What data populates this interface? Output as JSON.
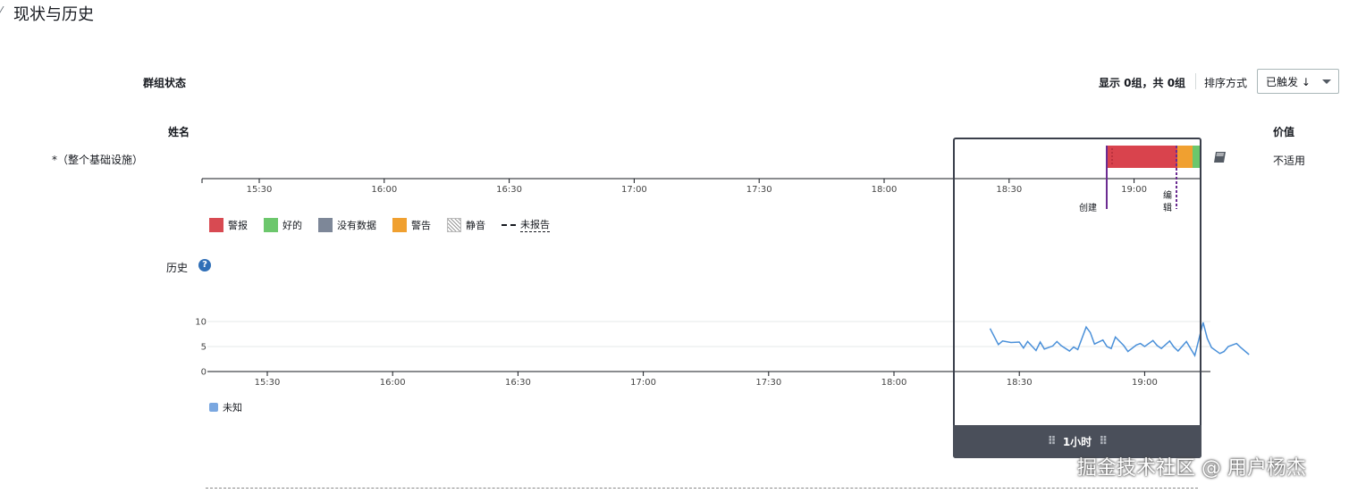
{
  "section": {
    "caret": "⁄",
    "title": "现状与历史"
  },
  "group_status": {
    "heading": "群组状态",
    "display_count": "显示 0组，共 0组",
    "sort_label": "排序方式",
    "sort_value": "已触发 ↓"
  },
  "table": {
    "col_name": "姓名",
    "col_value": "价值",
    "row": {
      "name": "*（整个基础设施）",
      "value": "不适用",
      "icon": "book-icon"
    }
  },
  "timeline": {
    "ticks": [
      "15:30",
      "16:00",
      "16:30",
      "17:00",
      "17:30",
      "18:00",
      "18:30",
      "19:00"
    ],
    "markers": {
      "create": "创建",
      "edit_1": "编",
      "edit_2": "辑"
    },
    "state_bar": [
      {
        "state": "警报",
        "fraction": 0.7,
        "color": "#d13212"
      },
      {
        "state": "警告",
        "fraction": 0.15,
        "color": "#f0a030"
      },
      {
        "state": "好的",
        "fraction": 0.1,
        "color": "#6cc76c"
      }
    ]
  },
  "legend": [
    {
      "label": "警报",
      "color": "#d84a52",
      "kind": "swatch"
    },
    {
      "label": "好的",
      "color": "#6cc76c",
      "kind": "swatch"
    },
    {
      "label": "没有数据",
      "color": "#7d8798",
      "kind": "swatch"
    },
    {
      "label": "警告",
      "color": "#f0a030",
      "kind": "swatch"
    },
    {
      "label": "静音",
      "color": "",
      "kind": "hatch"
    },
    {
      "label": "未报告",
      "color": "",
      "kind": "dash"
    }
  ],
  "history": {
    "title": "历史",
    "help_icon": "question-circle-icon",
    "help_glyph": "?",
    "legend_label": "未知",
    "legend_color": "#7aa7e0",
    "line_color": "#4a90d9"
  },
  "chart_data": {
    "type": "line",
    "title": "",
    "xlabel": "",
    "ylabel": "",
    "ylim": [
      0,
      10
    ],
    "yticks": [
      0,
      5,
      10
    ],
    "xticks": [
      "15:30",
      "16:00",
      "16:30",
      "17:00",
      "17:30",
      "18:00",
      "18:30",
      "19:00"
    ],
    "series": [
      {
        "name": "未知",
        "x": [
          "18:23",
          "18:25",
          "18:26",
          "18:28",
          "18:30",
          "18:31",
          "18:32",
          "18:34",
          "18:35",
          "18:36",
          "18:38",
          "18:39",
          "18:40",
          "18:42",
          "18:43",
          "18:44",
          "18:46",
          "18:47",
          "18:48",
          "18:50",
          "18:51",
          "18:52",
          "18:53",
          "18:55",
          "18:56",
          "18:58",
          "18:59",
          "19:00",
          "19:02",
          "19:03",
          "19:04",
          "19:06",
          "19:07",
          "19:08",
          "19:10",
          "19:11",
          "19:12",
          "19:14",
          "19:15",
          "19:16",
          "19:18",
          "19:19",
          "19:20",
          "19:22",
          "19:23",
          "19:25"
        ],
        "y": [
          8.6,
          5.4,
          6.1,
          5.8,
          5.9,
          4.7,
          6.0,
          4.2,
          5.9,
          4.5,
          5.1,
          6.0,
          5.2,
          4.1,
          4.9,
          4.4,
          8.9,
          7.8,
          5.5,
          6.3,
          5.0,
          4.6,
          6.9,
          5.2,
          4.0,
          5.3,
          5.6,
          5.0,
          6.2,
          5.2,
          4.6,
          6.1,
          4.9,
          4.1,
          6.0,
          4.6,
          3.2,
          9.8,
          6.6,
          4.8,
          3.6,
          4.0,
          5.0,
          5.6,
          4.8,
          3.4
        ]
      }
    ]
  },
  "zoom": {
    "label": "1小时",
    "grip": "⠿"
  },
  "watermark": "掘金技术社区 @ 用户杨杰"
}
